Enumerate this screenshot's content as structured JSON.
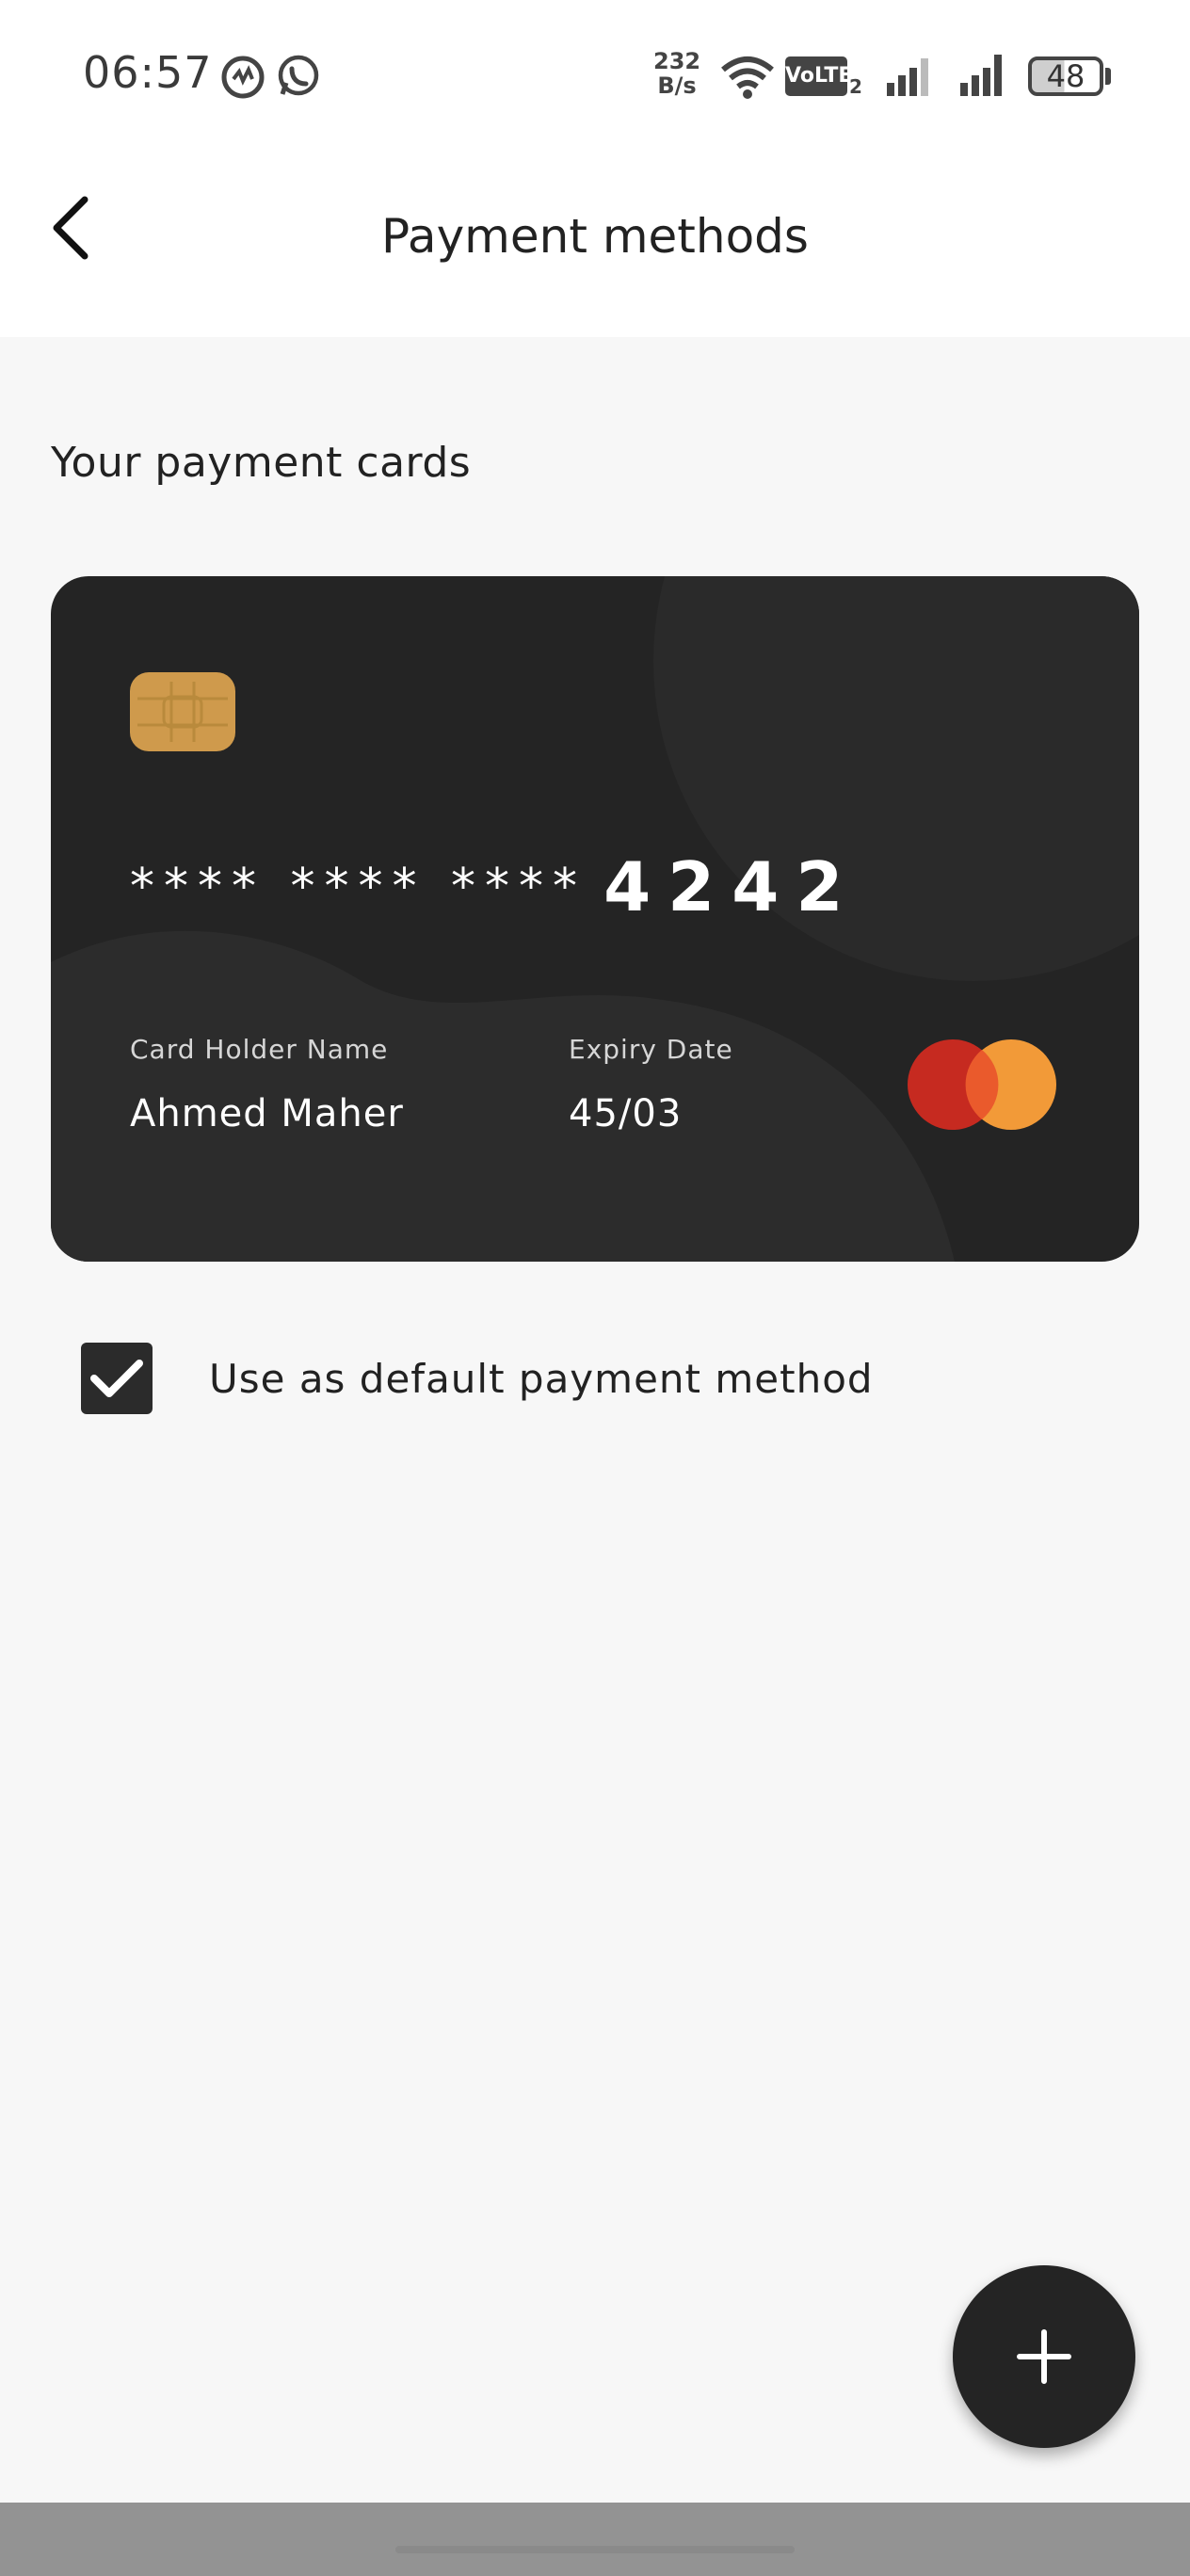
{
  "status_bar": {
    "time": "06:57",
    "net_speed_value": "232",
    "net_speed_unit": "B/s",
    "volte": "VoLTE",
    "volte_sim": "2",
    "battery": "48",
    "battery_level": 0.48,
    "icons": [
      "app-notification-icon",
      "whatsapp-icon",
      "wifi-icon",
      "signal-sim1-icon",
      "signal-sim2-icon"
    ]
  },
  "header": {
    "title": "Payment methods",
    "back_icon": "chevron-left-icon"
  },
  "section": {
    "title": "Your payment cards"
  },
  "card": {
    "masked_number": "**** **** ****",
    "last4": "4242",
    "holder_label": "Card Holder Name",
    "holder_name": "Ahmed Maher",
    "expiry_label": "Expiry Date",
    "expiry_value": "45/03",
    "brand_icon": "mastercard-logo-icon",
    "colors": {
      "background": "#242424",
      "chip": "#cf9a4c",
      "brand_red": "#c62a20",
      "brand_orange": "#f29a38"
    }
  },
  "default_option": {
    "label": "Use as default payment method",
    "checked": true
  },
  "fab": {
    "icon": "plus-icon"
  }
}
